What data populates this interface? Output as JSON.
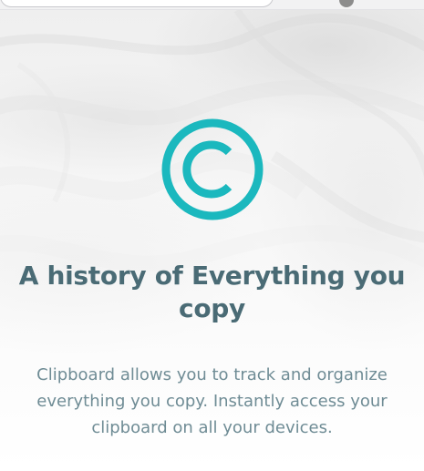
{
  "hero": {
    "title": "A history of Everything you copy",
    "description": "Clipboard allows you to track and organize everything you copy. Instantly access your clipboard on all your devices."
  },
  "logo": {
    "icon": "copyright-icon",
    "color": "#1bb8be"
  },
  "colors": {
    "title": "#4a6b75",
    "description": "#6f8c95"
  }
}
